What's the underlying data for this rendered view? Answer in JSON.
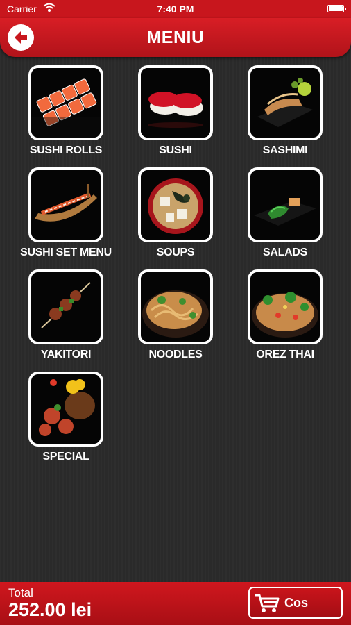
{
  "status_bar": {
    "carrier": "Carrier",
    "time": "7:40 PM"
  },
  "header": {
    "title": "MENIU",
    "back_icon": "back-arrow-icon"
  },
  "menu": {
    "items": [
      {
        "label": "SUSHI ROLLS"
      },
      {
        "label": "SUSHI"
      },
      {
        "label": "SASHIMI"
      },
      {
        "label": "SUSHI SET MENU"
      },
      {
        "label": "SOUPS"
      },
      {
        "label": "SALADS"
      },
      {
        "label": "YAKITORI"
      },
      {
        "label": "NOODLES"
      },
      {
        "label": "OREZ THAI"
      },
      {
        "label": "SPECIAL"
      }
    ]
  },
  "footer": {
    "total_label": "Total",
    "total_value": "252.00 lei",
    "cart_label": "Cos",
    "cart_icon": "shopping-cart-icon"
  },
  "colors": {
    "brand_red": "#c8161d",
    "background": "#2b2b2b",
    "text": "#ffffff"
  }
}
